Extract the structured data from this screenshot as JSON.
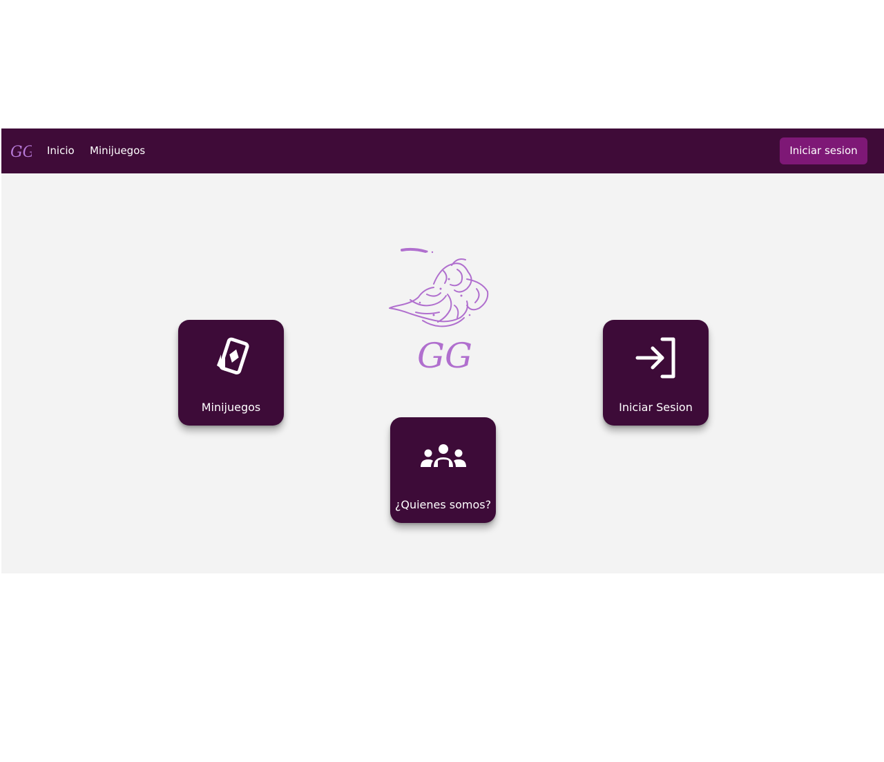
{
  "navbar": {
    "brand_text": "GG",
    "links": [
      {
        "label": "Inicio"
      },
      {
        "label": "Minijuegos"
      }
    ],
    "login_button": "Iniciar sesion"
  },
  "hero": {
    "logo_text": "GG"
  },
  "cards": {
    "minigames": {
      "label": "Minijuegos",
      "icon": "playing-card-icon"
    },
    "login": {
      "label": "Iniciar Sesion",
      "icon": "login-icon"
    },
    "about": {
      "label": "¿Quienes somos?",
      "icon": "group-icon"
    }
  },
  "colors": {
    "navbar_bg": "#3f0b38",
    "button_bg": "#7e1876",
    "card_bg": "#3d0b38",
    "logo_purple": "#b06fce",
    "page_bg": "#f3f3f3"
  }
}
